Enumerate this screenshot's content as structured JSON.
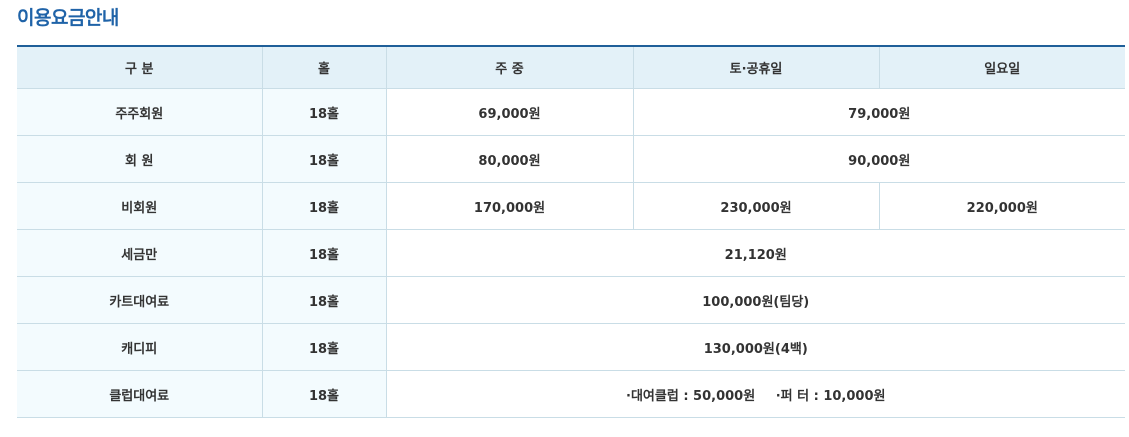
{
  "page_title": "이용요금안내",
  "table": {
    "headers": [
      "구 분",
      "홀",
      "주 중",
      "토·공휴일",
      "일요일"
    ],
    "rows": [
      {
        "label": "주주회원",
        "holes": "18홀",
        "weekday": "69,000원",
        "weekend": "79,000원"
      },
      {
        "label": "회 원",
        "holes": "18홀",
        "weekday": "80,000원",
        "weekend": "90,000원"
      },
      {
        "label": "비회원",
        "holes": "18홀",
        "weekday": "170,000원",
        "saturday": "230,000원",
        "sunday": "220,000원"
      },
      {
        "label": "세금만",
        "holes": "18홀",
        "all": "21,120원"
      },
      {
        "label": "카트대여료",
        "holes": "18홀",
        "all": "100,000원(팀당)"
      },
      {
        "label": "캐디피",
        "holes": "18홀",
        "all": "130,000원(4백)"
      },
      {
        "label": "클럽대여료",
        "holes": "18홀",
        "club_rental": "·대여클럽 : 50,000원",
        "putter_rental": "·퍼 터 : 10,000원"
      }
    ]
  }
}
